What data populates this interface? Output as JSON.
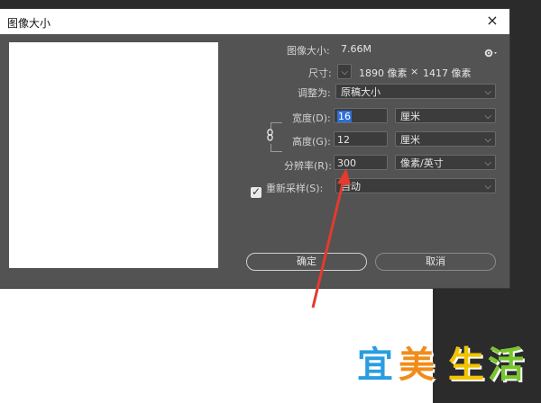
{
  "dialog": {
    "title": "图像大小",
    "close_glyph": "×",
    "image_size_label": "图像大小:",
    "image_size_value": "7.66M",
    "gear_icon": "gear-icon",
    "dimensions_label": "尺寸:",
    "dimensions_value_w": "1890 像素",
    "dimensions_x": "×",
    "dimensions_value_h": "1417 像素",
    "fit_label": "调整为:",
    "fit_value": "原稿大小",
    "width_label": "宽度(D):",
    "width_value": "16",
    "width_unit": "厘米",
    "height_label": "高度(G):",
    "height_value": "12",
    "height_unit": "厘米",
    "resolution_label": "分辨率(R):",
    "resolution_value": "300",
    "resolution_unit": "像素/英寸",
    "resample_label": "重新采样(S):",
    "resample_checked": true,
    "resample_value": "自动",
    "ok_label": "确定",
    "cancel_label": "取消"
  },
  "watermark": {
    "chars": [
      "宜",
      "美",
      "生",
      "活"
    ],
    "colors": [
      "#2a9de0",
      "#f08c1a",
      "#f2c400",
      "#77c62c"
    ]
  },
  "annotation": {
    "arrow_color": "#e33b2e"
  }
}
